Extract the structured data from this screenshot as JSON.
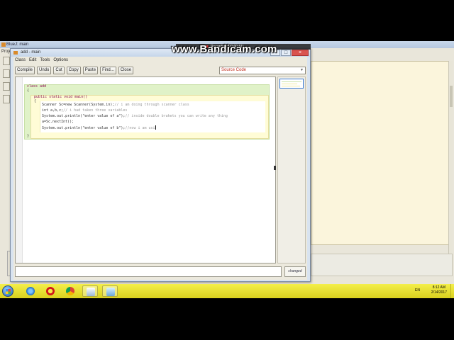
{
  "background_window": {
    "title": "BlueJ: main",
    "menu_label": "Proje"
  },
  "editor": {
    "title": "add - main",
    "menu": [
      "Class",
      "Edit",
      "Tools",
      "Options"
    ],
    "toolbar": {
      "compile": "Compile",
      "undo": "Undo",
      "cut": "Cut",
      "copy": "Copy",
      "paste": "Paste",
      "find": "Find...",
      "close": "Close"
    },
    "view_select": "Source Code",
    "status_message": "",
    "changed_label": "changed",
    "code": {
      "line1": "class add",
      "line2": "{",
      "line3": "public static void main()",
      "line4": "{",
      "line5_code": "Scanner Sc=new Scanner(System.in);",
      "line5_comment": "// i am doing through scanner class",
      "line6_code": "int a,b,c;",
      "line6_comment": "// i had taken three variables",
      "line7_code": "System.out.println(\"enter value of a\");",
      "line7_comment": "// inside double brakets you can write any thing",
      "line8_code": "a=Sc.nextInt();",
      "line9_code": "System.out.println(\"enter value of b\");",
      "line9_comment": "//now i am usi",
      "line10": "}"
    }
  },
  "recorder": {
    "watermark": "www.Bandicam.com",
    "status": "Recording [00:00:51]"
  },
  "taskbar": {
    "language": "EN",
    "time": "8:12 AM",
    "date": "2/14/2017"
  },
  "colors": {
    "class_block": "#e0f2c8",
    "method_block": "#fffcd6",
    "taskbar": "#e6dd2e",
    "keyword": "#8a1050"
  }
}
